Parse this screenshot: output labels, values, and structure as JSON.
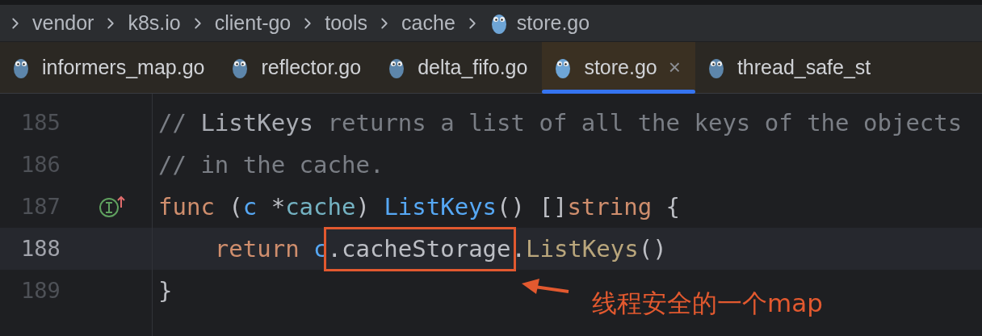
{
  "breadcrumb": [
    {
      "label": "vendor",
      "kind": "folder"
    },
    {
      "label": "k8s.io",
      "kind": "folder"
    },
    {
      "label": "client-go",
      "kind": "folder"
    },
    {
      "label": "tools",
      "kind": "folder"
    },
    {
      "label": "cache",
      "kind": "folder"
    },
    {
      "label": "store.go",
      "kind": "file"
    }
  ],
  "tabs": [
    {
      "label": "informers_map.go",
      "selected": false
    },
    {
      "label": "reflector.go",
      "selected": false
    },
    {
      "label": "delta_fifo.go",
      "selected": false
    },
    {
      "label": "store.go",
      "selected": true,
      "close": "×"
    },
    {
      "label": "thread_safe_st",
      "selected": false
    }
  ],
  "lines": [
    {
      "number": "185",
      "current": false,
      "implements_marker": false,
      "tokens": [
        {
          "text": "// ",
          "kind": "comment"
        },
        {
          "text": "ListKeys",
          "kind": "comment_ref"
        },
        {
          "text": " returns a list of all the keys of the objects",
          "kind": "comment"
        }
      ]
    },
    {
      "number": "186",
      "current": false,
      "implements_marker": false,
      "tokens": [
        {
          "text": "// in the cache.",
          "kind": "comment"
        }
      ]
    },
    {
      "number": "187",
      "current": false,
      "implements_marker": true,
      "tokens": [
        {
          "text": "func",
          "kind": "keyword"
        },
        {
          "text": " (",
          "kind": "plain"
        },
        {
          "text": "c",
          "kind": "param"
        },
        {
          "text": " *",
          "kind": "plain"
        },
        {
          "text": "cache",
          "kind": "type"
        },
        {
          "text": ") ",
          "kind": "plain"
        },
        {
          "text": "ListKeys",
          "kind": "function"
        },
        {
          "text": "() []",
          "kind": "plain"
        },
        {
          "text": "string",
          "kind": "keyword"
        },
        {
          "text": " {",
          "kind": "plain"
        }
      ]
    },
    {
      "number": "188",
      "current": true,
      "implements_marker": false,
      "tokens": [
        {
          "text": "    return",
          "kind": "keyword"
        },
        {
          "text": " c",
          "kind": "param"
        },
        {
          "text": ".cacheStorage",
          "kind": "plain",
          "boxed": true
        },
        {
          "text": ".",
          "kind": "plain"
        },
        {
          "text": "ListKeys",
          "kind": "method"
        },
        {
          "text": "()",
          "kind": "plain"
        }
      ]
    },
    {
      "number": "189",
      "current": false,
      "implements_marker": false,
      "tokens": [
        {
          "text": "}",
          "kind": "plain"
        }
      ]
    }
  ],
  "annotation": {
    "text": "线程安全的一个map"
  }
}
